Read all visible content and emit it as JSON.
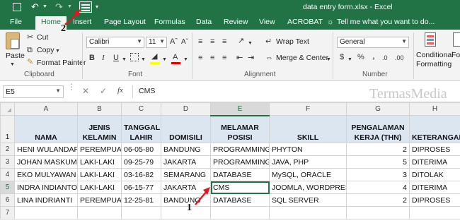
{
  "title_bar": {
    "filename": "data entry form.xlsx - Excel",
    "qat_form_icon": "form-icon"
  },
  "tabs": [
    "File",
    "Home",
    "Insert",
    "Page Layout",
    "Formulas",
    "Data",
    "Review",
    "View",
    "ACROBAT"
  ],
  "tell_me": "Tell me what you want to do...",
  "ribbon": {
    "clipboard": {
      "paste": "Paste",
      "cut": "Cut",
      "copy": "Copy",
      "format_painter": "Format Painter",
      "label": "Clipboard"
    },
    "font": {
      "name": "Calibri",
      "size": "11",
      "label": "Font"
    },
    "alignment": {
      "wrap_text": "Wrap Text",
      "merge_center": "Merge & Center",
      "label": "Alignment"
    },
    "number": {
      "format": "General",
      "label": "Number",
      "percent": "%",
      "comma": ","
    },
    "styles": {
      "conditional_formatting": "Conditional Formatting",
      "format_as_table": "Fo"
    }
  },
  "formula_bar": {
    "name_box": "E5",
    "fx": "fx",
    "value": "CMS"
  },
  "watermark": "TermasMedia",
  "annotations": {
    "one": "1",
    "two": "2"
  },
  "columns": [
    "A",
    "B",
    "C",
    "D",
    "E",
    "F",
    "G",
    "H"
  ],
  "header_row": [
    "NAMA",
    "JENIS KELAMIN",
    "TANGGAL LAHIR",
    "DOMISILI",
    "MELAMAR POSISI",
    "SKILL",
    "PENGALAMAN KERJA (THN)",
    "KETERANGAN"
  ],
  "rows": [
    [
      "HENI WULANDARI",
      "PEREMPUAN",
      "06-05-80",
      "BANDUNG",
      "PROGRAMMING",
      "PHYTON",
      "2",
      "DIPROSES"
    ],
    [
      "JOHAN MASKUM",
      "LAKI-LAKI",
      "09-25-79",
      "JAKARTA",
      "PROGRAMMING",
      "JAVA, PHP",
      "5",
      "DITERIMA"
    ],
    [
      "EKO MULYAWAN",
      "LAKI-LAKI",
      "03-16-82",
      "SEMARANG",
      "DATABASE",
      "MySQL, ORACLE",
      "3",
      "DITOLAK"
    ],
    [
      "INDRA INDIANTO",
      "LAKI-LAKI",
      "06-15-77",
      "JAKARTA",
      "CMS",
      "JOOMLA, WORDPRESS",
      "4",
      "DITERIMA"
    ],
    [
      "LINA INDRIANTI",
      "PEREMPUAN",
      "12-25-81",
      "BANDUNG",
      "DATABASE",
      "SQL SERVER",
      "2",
      "DIPROSES"
    ]
  ],
  "row_numbers": [
    "1",
    "2",
    "3",
    "4",
    "5",
    "6",
    "7"
  ],
  "colors": {
    "excel_green": "#217346",
    "header_fill": "#dce6f1",
    "annotation_arrow": "#e8131b"
  }
}
